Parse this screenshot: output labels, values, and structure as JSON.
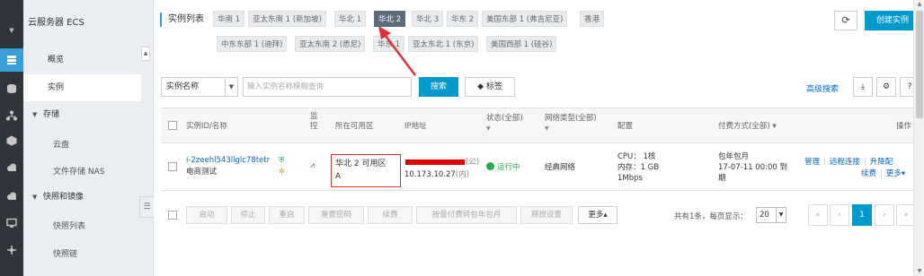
{
  "sidebar": {
    "product_title": "云服务器 ECS",
    "items": [
      {
        "label": "概览"
      },
      {
        "label": "实例"
      }
    ],
    "groups": [
      {
        "label": "存储",
        "children": [
          {
            "label": "云盘"
          },
          {
            "label": "文件存储 NAS"
          }
        ]
      },
      {
        "label": "快照和镜像",
        "children": [
          {
            "label": "快照列表"
          },
          {
            "label": "快照链"
          }
        ]
      }
    ],
    "collapse_glyph": "☰"
  },
  "header": {
    "section_label": "实例列表",
    "regions_row1": [
      "华南 1",
      "亚太东南 1 (新加坡)",
      "华北 1",
      "华北 2",
      "华北 3",
      "华东 2",
      "美国东部 1 (弗吉尼亚)",
      "香港"
    ],
    "regions_row2": [
      "中东东部 1 (迪拜)",
      "亚太东南 2 (悉尼)",
      "华东 1",
      "亚太东北 1 (东京)",
      "美国西部 1 (硅谷)"
    ],
    "active_region": "华北 2",
    "refresh_glyph": "⟳",
    "create_label": "创建实例"
  },
  "search": {
    "field_select": "实例名称",
    "placeholder": "输入实例名称模糊查询",
    "search_label": "搜索",
    "tag_label": "标签",
    "advanced_label": "高级搜索"
  },
  "table": {
    "headers": {
      "id_name": "实例ID/名称",
      "monitor_1": "监",
      "monitor_2": "控",
      "zone": "所在可用区",
      "ip": "IP地址",
      "status": "状态(全部)",
      "network": "网络类型(全部)",
      "config": "配置",
      "billing": "付费方式(全部)",
      "ops": "操作"
    },
    "row": {
      "instance_id": "i-2zeehl543llglc78tetr",
      "instance_name": "电商测试",
      "zone_line1": "华北 2 可用区",
      "zone_line2": "A",
      "ip_public_suffix": "(公)",
      "ip_private": "10.173.10.27",
      "ip_private_suffix": "(内)",
      "status": "运行中",
      "network": "经典网络",
      "cpu": "CPU： 1核",
      "memory": "内存：1 GB",
      "bandwidth": "1Mbps",
      "billing_type": "包年包月",
      "expire": "17-07-11 00:00 到",
      "expire_2": "期",
      "op_manage": "管理",
      "op_remote": "远程连接",
      "op_upgrade": "升降配",
      "op_renew": "续费",
      "op_more": "更多"
    }
  },
  "footer": {
    "buttons": [
      "启动",
      "停止",
      "重启",
      "重置密码",
      "续费",
      "按量付费转包年包月",
      "释放设置"
    ],
    "more_label": "更多",
    "total_text": "共有1条，每页显示：",
    "page_size": "20",
    "current_page": "1",
    "pager": [
      "«",
      "‹",
      "1",
      "›",
      "»"
    ]
  },
  "colors": {
    "accent": "#0099cc",
    "rail_bg": "#2f353b",
    "sidebar_bg": "#eaedf1",
    "status_green": "#1fb14c",
    "annotation_red": "#e03030"
  }
}
